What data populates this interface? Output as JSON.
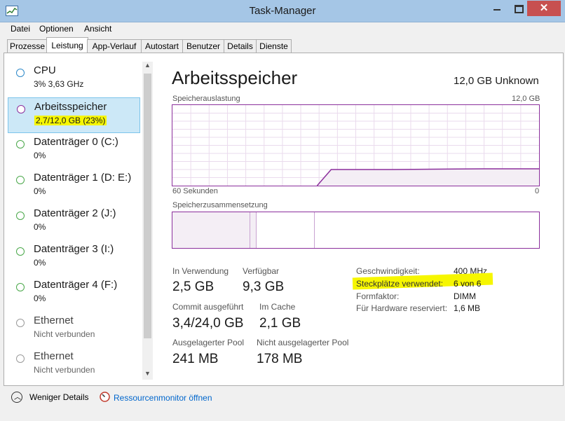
{
  "window": {
    "title": "Task-Manager",
    "close_glyph": "✕"
  },
  "menu": [
    "Datei",
    "Optionen",
    "Ansicht"
  ],
  "tabs": [
    "Prozesse",
    "Leistung",
    "App-Verlauf",
    "Autostart",
    "Benutzer",
    "Details",
    "Dienste"
  ],
  "active_tab": "Leistung",
  "sidebar": {
    "items": [
      {
        "title": "CPU",
        "sub": "3% 3,63 GHz",
        "icon": "circle-icon",
        "color": "#2e89c9"
      },
      {
        "title": "Arbeitsspeicher",
        "sub": "2,7/12,0 GB (23%)",
        "icon": "circle-icon",
        "color": "#8b2f9c",
        "selected": true
      },
      {
        "title": "Datenträger 0 (C:)",
        "sub": "0%",
        "icon": "circle-icon",
        "color": "#4aa84a"
      },
      {
        "title": "Datenträger 1 (D: E:)",
        "sub": "0%",
        "icon": "circle-icon",
        "color": "#4aa84a"
      },
      {
        "title": "Datenträger 2 (J:)",
        "sub": "0%",
        "icon": "circle-icon",
        "color": "#4aa84a"
      },
      {
        "title": "Datenträger 3 (I:)",
        "sub": "0%",
        "icon": "circle-icon",
        "color": "#4aa84a"
      },
      {
        "title": "Datenträger 4 (F:)",
        "sub": "0%",
        "icon": "circle-icon",
        "color": "#4aa84a"
      },
      {
        "title": "Ethernet",
        "sub": "Nicht verbunden",
        "icon": "circle-icon",
        "color": "#9a9a9a"
      },
      {
        "title": "Ethernet",
        "sub": "Nicht verbunden",
        "icon": "circle-icon",
        "color": "#9a9a9a"
      }
    ]
  },
  "main": {
    "title": "Arbeitsspeicher",
    "total": "12,0 GB Unknown",
    "usage_label": "Speicherauslastung",
    "usage_max": "12,0 GB",
    "time_left": "60 Sekunden",
    "time_right": "0",
    "usage_fraction": 0.23,
    "composition_label": "Speicherzusammensetzung",
    "stats": [
      {
        "label": "In Verwendung",
        "value": "2,5 GB"
      },
      {
        "label": "Verfügbar",
        "value": "9,3 GB"
      },
      {
        "label": "Commit ausgeführt",
        "value": "3,4/24,0 GB"
      },
      {
        "label": "Im Cache",
        "value": "2,1 GB"
      },
      {
        "label": "Ausgelagerter Pool",
        "value": "241 MB"
      },
      {
        "label": "Nicht ausgelagerter Pool",
        "value": "178 MB"
      }
    ],
    "details": [
      {
        "label": "Geschwindigkeit:",
        "value": "400 MHz"
      },
      {
        "label": "Steckplätze verwendet:",
        "value": "6 von 6"
      },
      {
        "label": "Formfaktor:",
        "value": "DIMM"
      },
      {
        "label": "Für Hardware reserviert:",
        "value": "1,6 MB"
      }
    ],
    "accent_color": "#8b2f9c"
  },
  "footer": {
    "less_details": "Weniger Details",
    "resource_monitor": "Ressourcenmonitor öffnen"
  }
}
